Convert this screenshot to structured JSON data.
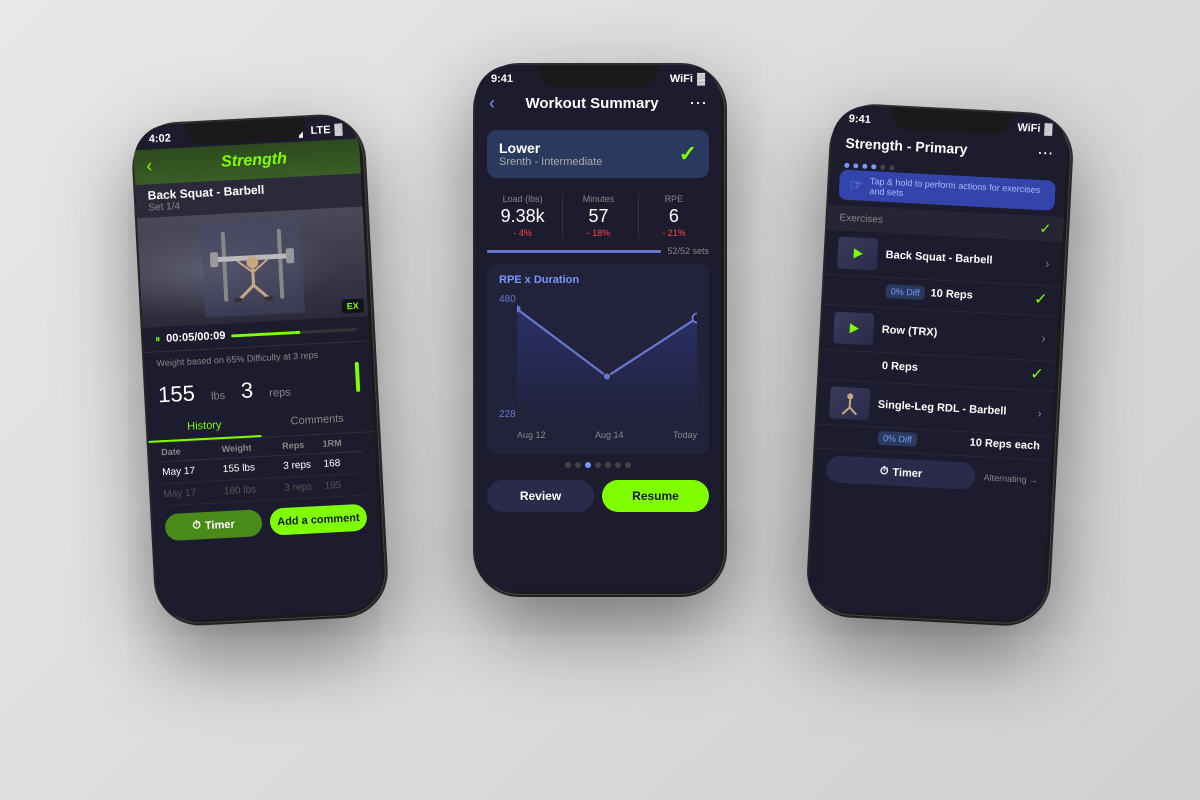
{
  "left_phone": {
    "status_time": "4:02",
    "status_signal": "LTE",
    "header_title": "Strength",
    "exercise_name": "Back Squat - Barbell",
    "exercise_set": "Set 1/4",
    "timer": "00:05/00:09",
    "weight_hint": "Weight based on 65% Difficulty at 3 reps",
    "weight_value": "155",
    "weight_unit": "lbs",
    "reps_value": "3",
    "reps_label": "reps",
    "tab_history": "History",
    "tab_comments": "Comments",
    "history_headers": [
      "Date",
      "Weight",
      "Reps",
      "1RM"
    ],
    "history_rows": [
      {
        "date": "May 17",
        "weight": "155 lbs",
        "reps": "3 reps",
        "orm": "168"
      },
      {
        "date": "May 17",
        "weight": "180 lbs",
        "reps": "3 reps",
        "orm": "195",
        "dim": true
      }
    ],
    "btn_timer": "Timer",
    "btn_comment": "Add a comment",
    "ex_badge": "EX"
  },
  "center_phone": {
    "status_time": "9:41",
    "header_title": "Workout Summary",
    "workout_name": "Lower",
    "workout_sub": "Srenth - Intermediate",
    "stats": [
      {
        "label": "Load (lbs)",
        "value": "9.38k",
        "change": "- 4%"
      },
      {
        "label": "Minutes",
        "value": "57",
        "change": "- 18%"
      },
      {
        "label": "RPE",
        "value": "6",
        "change": "- 21%"
      }
    ],
    "sets_label": "52/52 sets",
    "chart_title": "RPE x Duration",
    "chart_y_top": "480",
    "chart_y_bottom": "228",
    "chart_x_labels": [
      "Aug 12",
      "Aug 14",
      "Today"
    ],
    "btn_review": "Review",
    "btn_resume": "Resume",
    "dots_count": 7,
    "active_dot": 2
  },
  "right_phone": {
    "status_time": "9:41",
    "header_title": "Strength - Primary",
    "hint_text": "Tap & hold to perform actions for exercises and sets",
    "section_label": "Exercises",
    "exercises": [
      {
        "name": "Back Squat - Barbell",
        "diff": "0% Diff",
        "reps": "10 Reps",
        "has_check": true
      },
      {
        "name": "Row (TRX)",
        "diff": "",
        "reps": "0 Reps",
        "has_check": false
      },
      {
        "name": "Single-Leg RDL - Barbell",
        "diff": "0% Diff",
        "reps": "10 Reps each",
        "has_check": false
      }
    ],
    "btn_timer": "Timer",
    "alternating": "Alternating →"
  }
}
